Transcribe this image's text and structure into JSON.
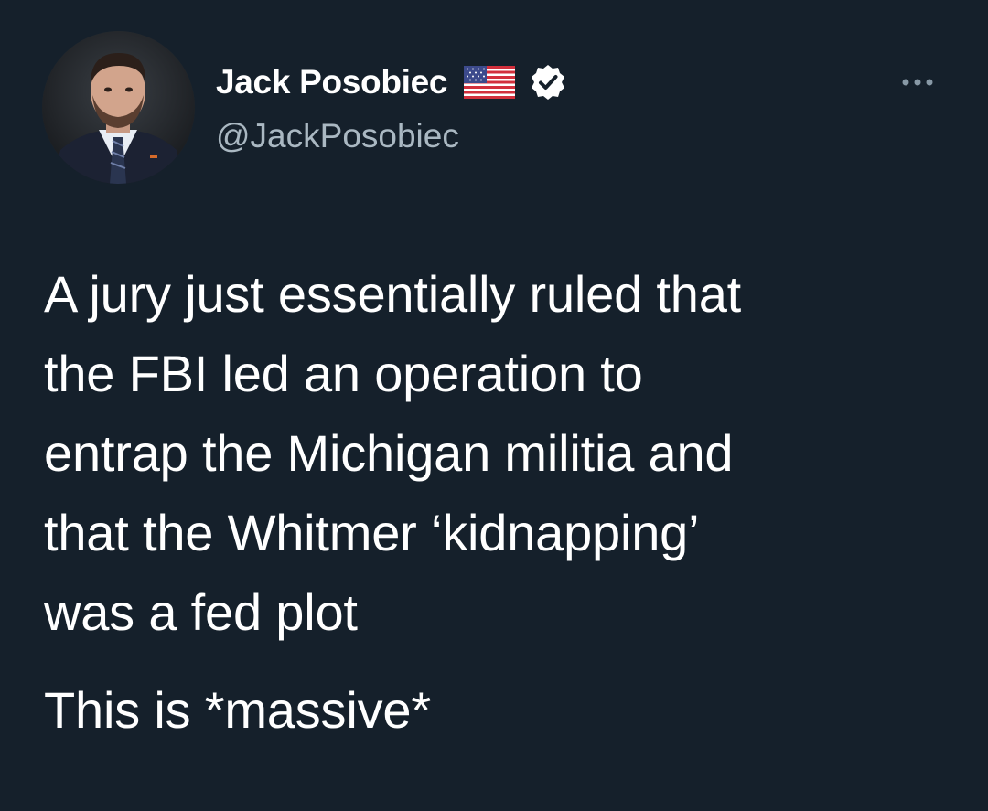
{
  "author": {
    "display_name": "Jack Posobiec",
    "handle": "@JackPosobiec",
    "flag_icon": "us-flag-icon",
    "verified_icon": "verified-badge-icon"
  },
  "menu": {
    "more_icon": "more-options-icon"
  },
  "tweet": {
    "lines": [
      "A jury just essentially ruled that",
      "the FBI led an operation to",
      "entrap the Michigan militia and",
      "that the Whitmer ‘kidnapping’",
      "was a fed plot"
    ],
    "second_paragraph": "This is *massive*"
  },
  "colors": {
    "background": "#15202b",
    "text": "#ffffff",
    "secondary_text": "#aab8c2"
  }
}
